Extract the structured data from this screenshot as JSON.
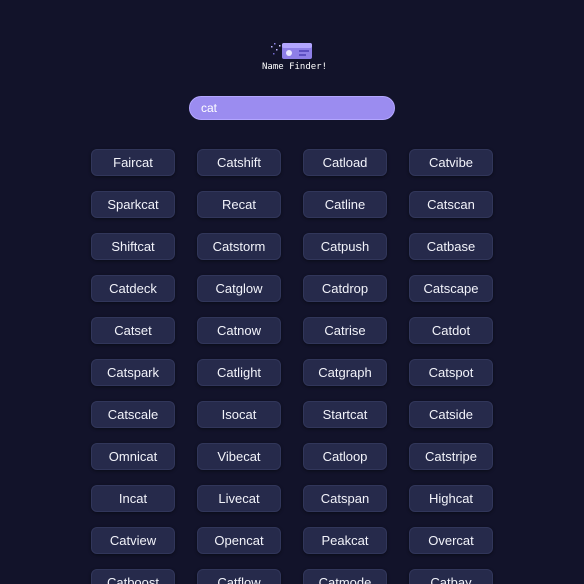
{
  "header": {
    "logo_icon": "catcard-logo-icon",
    "title": "Name Finder!"
  },
  "search": {
    "value": "cat",
    "placeholder": ""
  },
  "colors": {
    "background": "#12132a",
    "accent": "#9b8cf0",
    "button": "#262a4b"
  },
  "names": [
    "Faircat",
    "Catshift",
    "Catload",
    "Catvibe",
    "Sparkcat",
    "Recat",
    "Catline",
    "Catscan",
    "Shiftcat",
    "Catstorm",
    "Catpush",
    "Catbase",
    "Catdeck",
    "Catglow",
    "Catdrop",
    "Catscape",
    "Catset",
    "Catnow",
    "Catrise",
    "Catdot",
    "Catspark",
    "Catlight",
    "Catgraph",
    "Catspot",
    "Catscale",
    "Isocat",
    "Startcat",
    "Catside",
    "Omnicat",
    "Vibecat",
    "Catloop",
    "Catstripe",
    "Incat",
    "Livecat",
    "Catspan",
    "Highcat",
    "Catview",
    "Opencat",
    "Peakcat",
    "Overcat",
    "Catboost",
    "Catflow",
    "Catmode",
    "Catbay"
  ]
}
